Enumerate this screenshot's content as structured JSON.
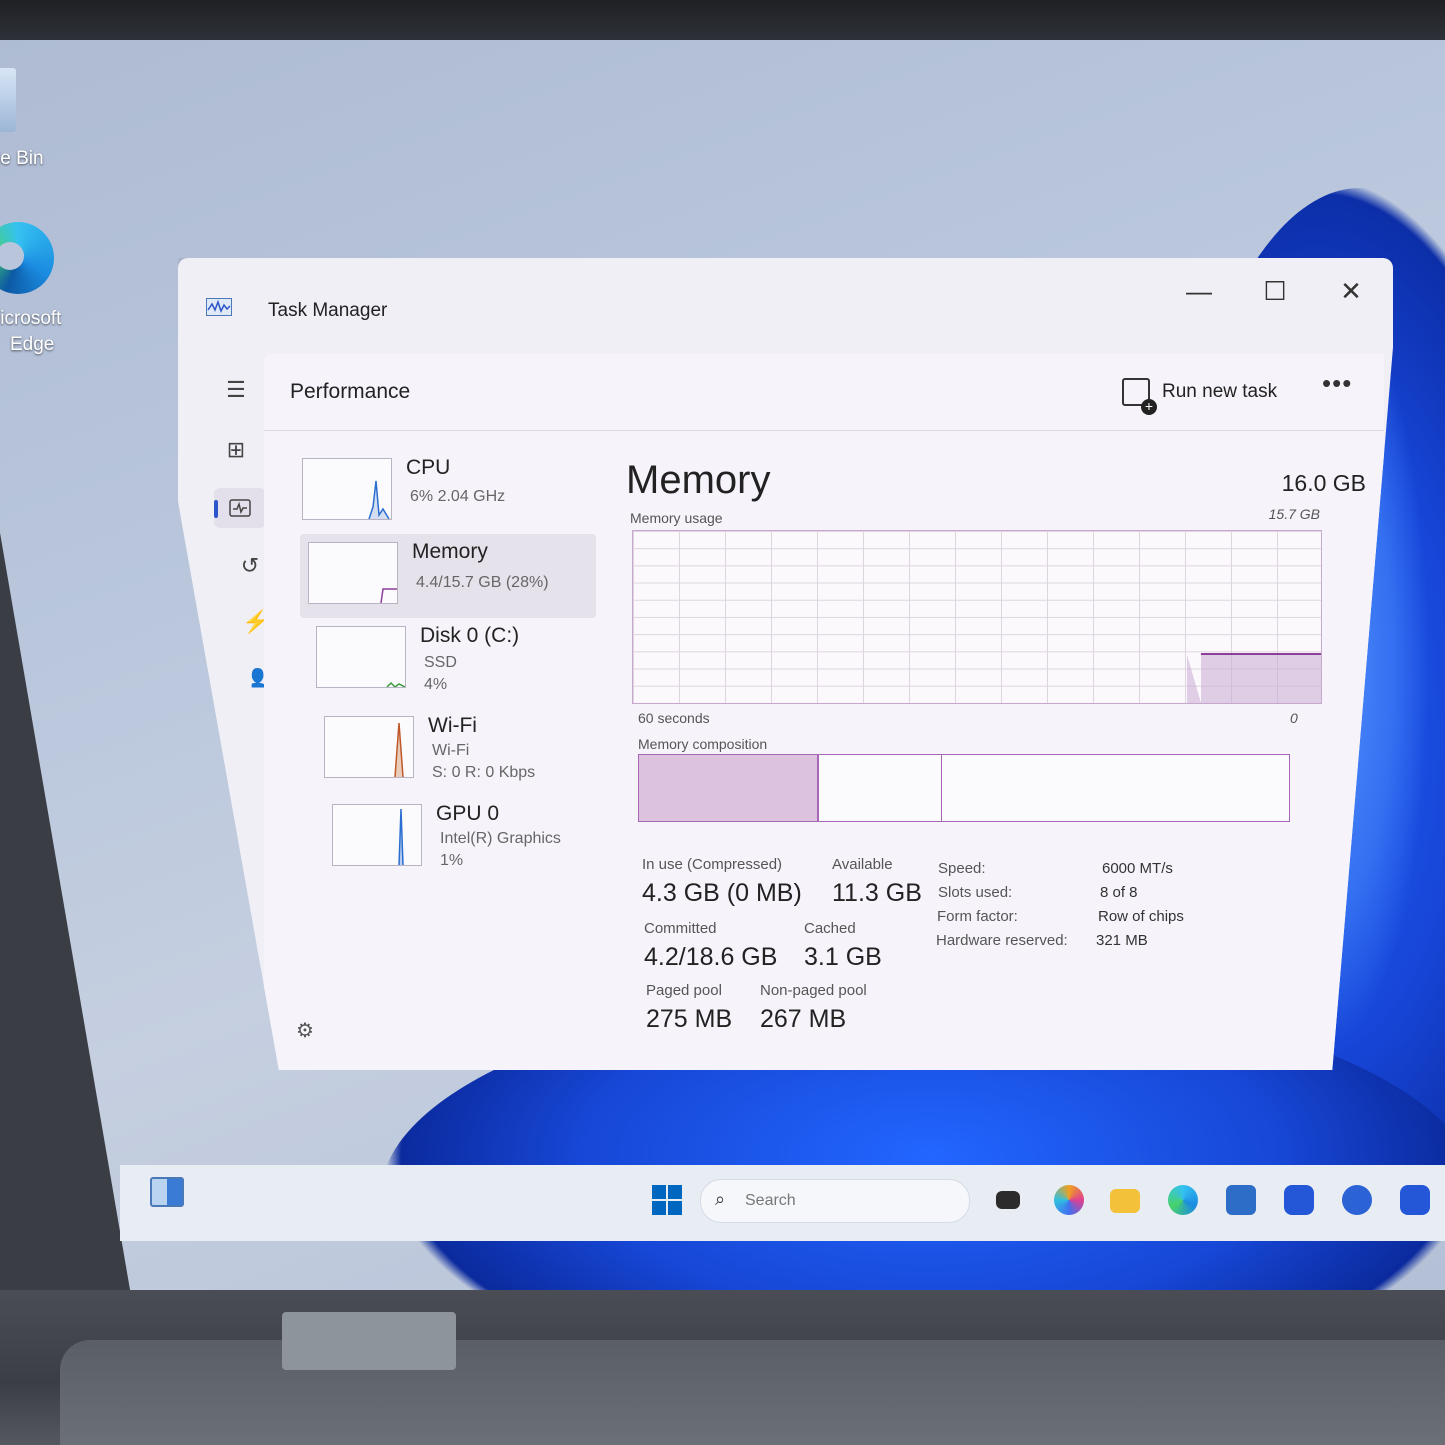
{
  "desktop": {
    "icons": [
      {
        "label": "le Bin"
      },
      {
        "label_line1": "licrosoft",
        "label_line2": "Edge"
      }
    ]
  },
  "window": {
    "title": "Task Manager",
    "controls": {
      "minimize": "—",
      "maximize": "☐",
      "close": "✕"
    }
  },
  "header": {
    "section_title": "Performance",
    "run_new_task": "Run new task",
    "more": "•••"
  },
  "sidebar_list": [
    {
      "name": "CPU",
      "sub1": "6%  2.04 GHz"
    },
    {
      "name": "Memory",
      "sub1": "4.4/15.7 GB (28%)"
    },
    {
      "name": "Disk 0 (C:)",
      "sub1": "SSD",
      "sub2": "4%"
    },
    {
      "name": "Wi-Fi",
      "sub1": "Wi-Fi",
      "sub2": "S: 0  R: 0 Kbps"
    },
    {
      "name": "GPU 0",
      "sub1": "Intel(R) Graphics",
      "sub2": "1%"
    }
  ],
  "memory": {
    "title": "Memory",
    "total": "16.0 GB",
    "usage_label": "Memory usage",
    "usage_max": "15.7 GB",
    "time_label": "60 seconds",
    "time_zero": "0",
    "composition_label": "Memory composition",
    "usage_fraction": 0.28,
    "stats": {
      "in_use_label": "In use (Compressed)",
      "in_use": "4.3 GB (0 MB)",
      "available_label": "Available",
      "available": "11.3 GB",
      "committed_label": "Committed",
      "committed": "4.2/18.6 GB",
      "cached_label": "Cached",
      "cached": "3.1 GB",
      "paged_label": "Paged pool",
      "paged": "275 MB",
      "nonpaged_label": "Non-paged pool",
      "nonpaged": "267 MB"
    },
    "specs": {
      "speed_label": "Speed:",
      "speed": "6000 MT/s",
      "slots_label": "Slots used:",
      "slots": "8 of 8",
      "form_label": "Form factor:",
      "form": "Row of chips",
      "hw_label": "Hardware reserved:",
      "hw": "321 MB"
    }
  },
  "taskbar": {
    "search_placeholder": "Search"
  },
  "colors": {
    "accent": "#2c55c9",
    "memory_purple": "#a866b6",
    "wallpaper_blue": "#1747d6"
  }
}
